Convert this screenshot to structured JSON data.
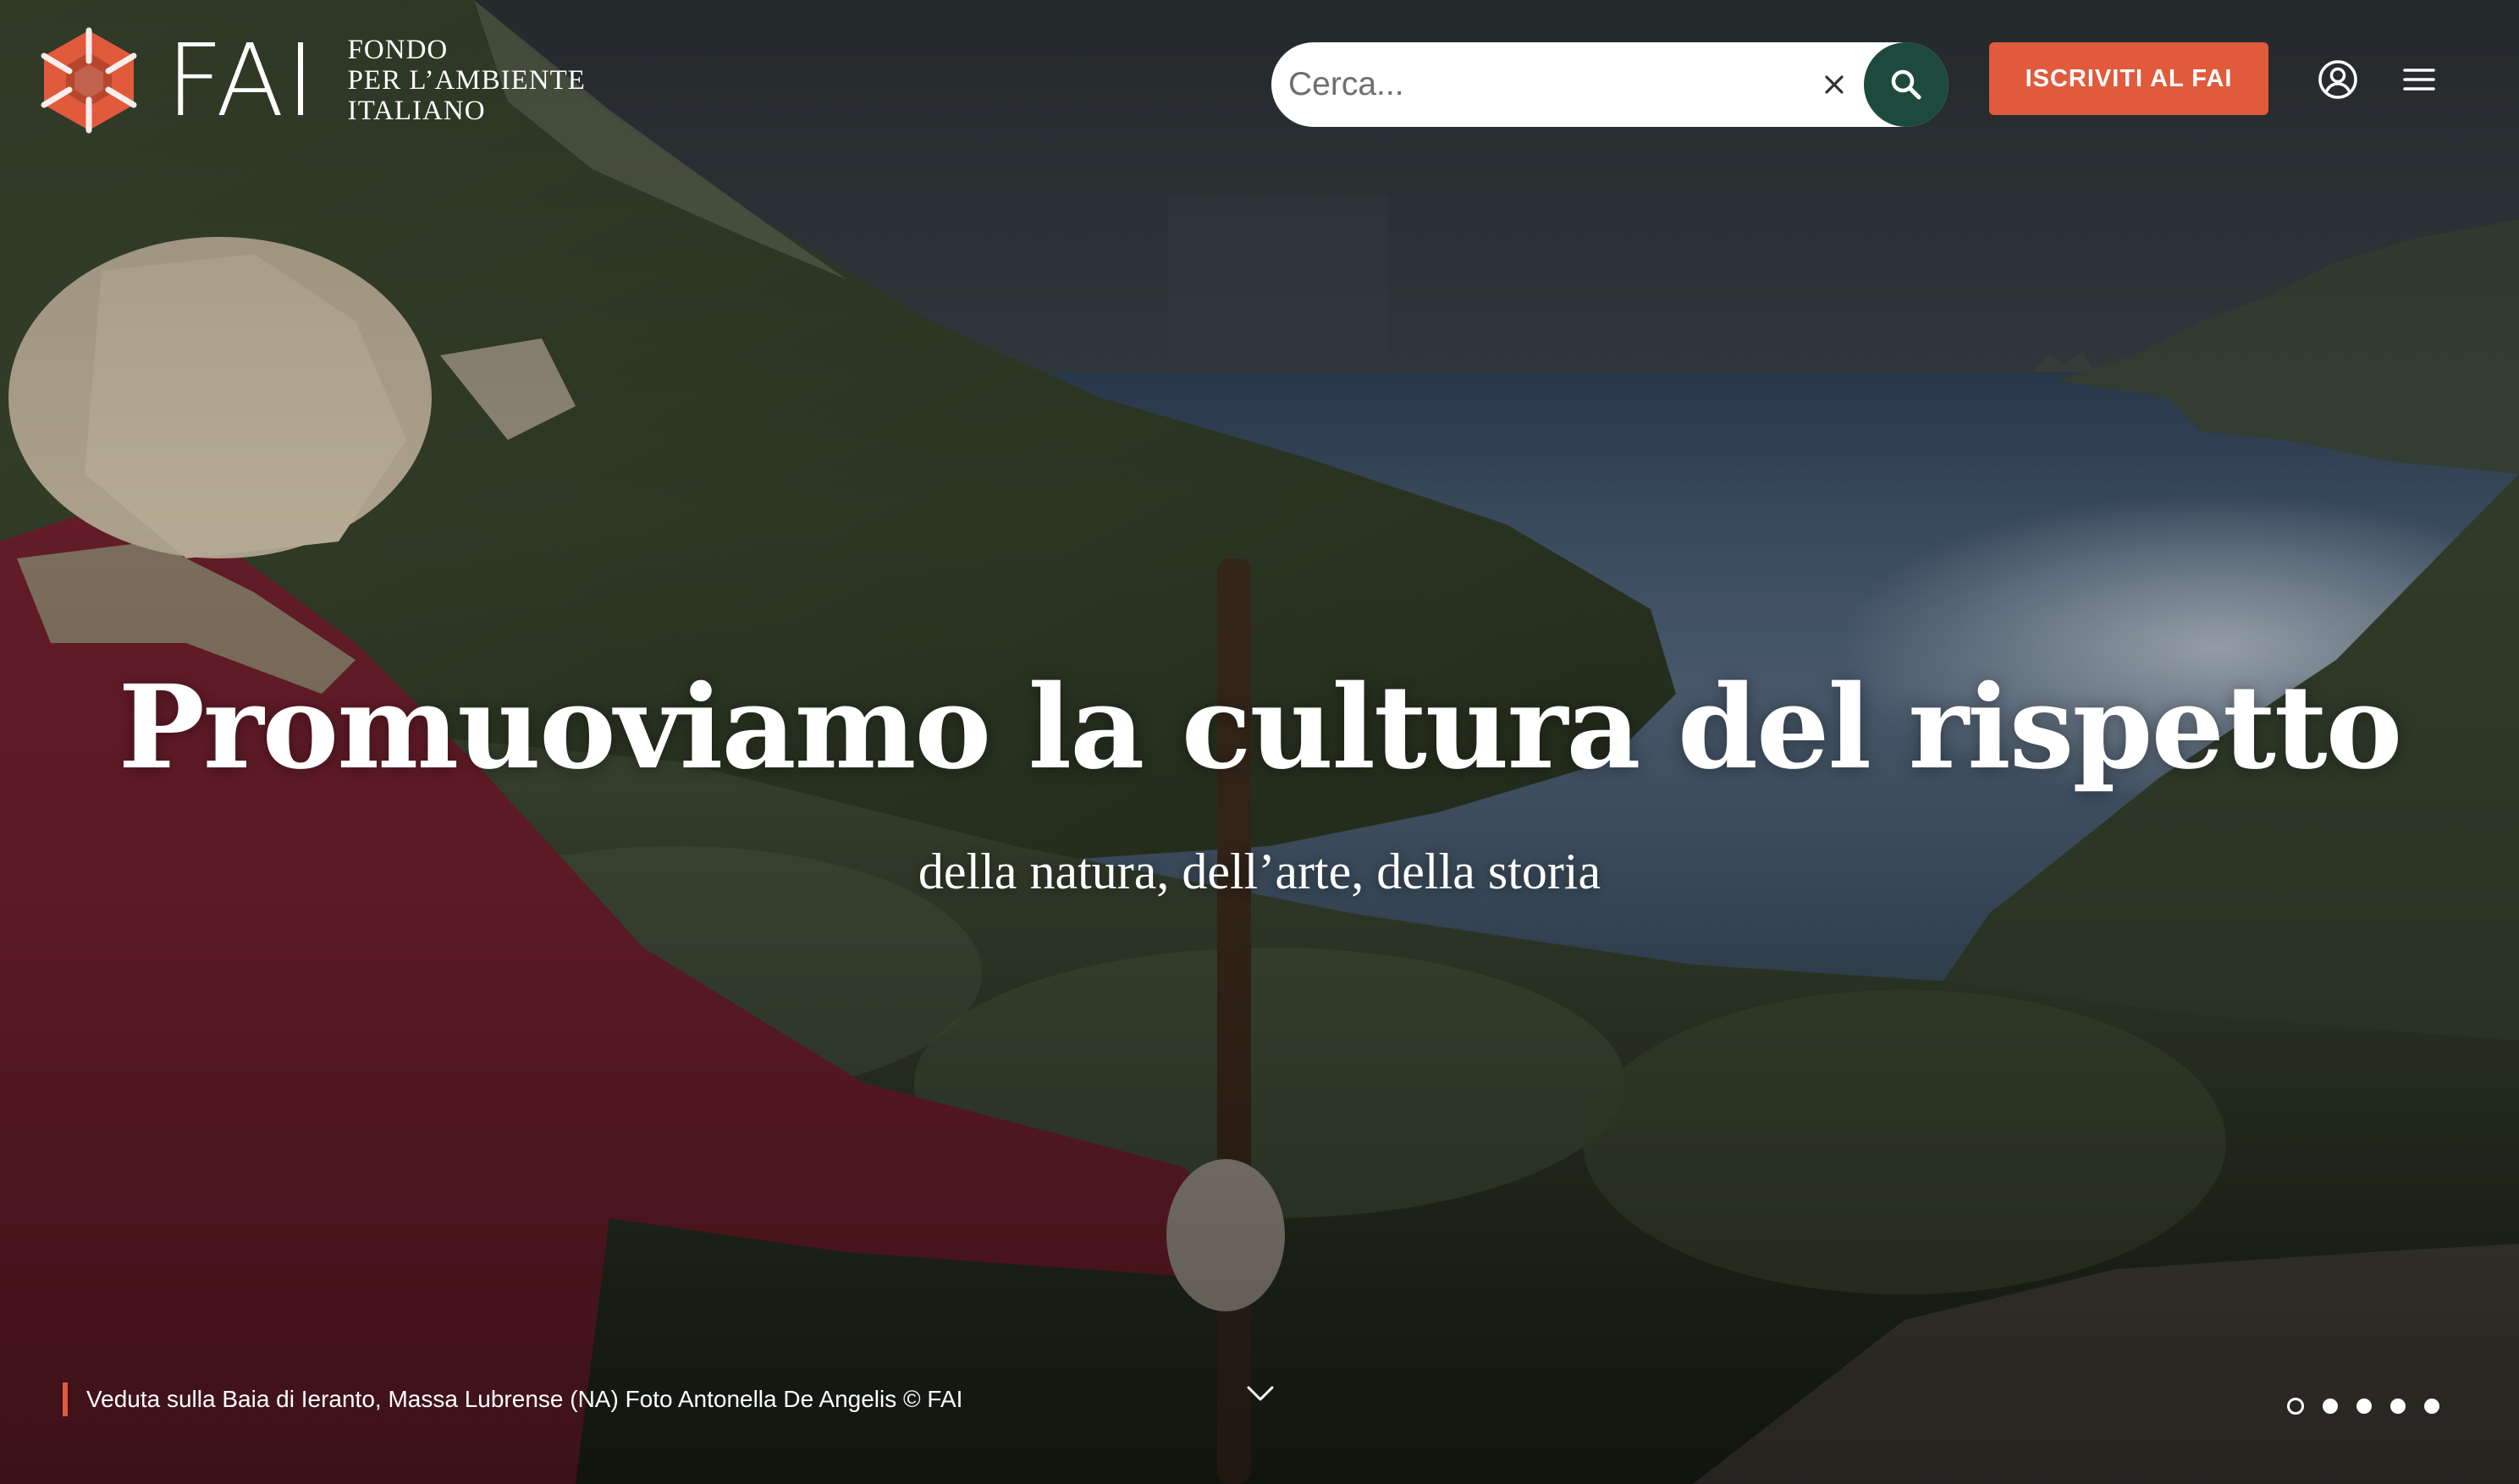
{
  "brand": {
    "name": "FAI",
    "tagline_lines": [
      "FONDO",
      "PER L’AMBIENTE",
      "ITALIANO"
    ],
    "color": "#e05a3b"
  },
  "search": {
    "placeholder": "Cerca...",
    "clear_icon": "close-icon",
    "submit_icon": "search-icon",
    "button_color": "#1d4a3c"
  },
  "header": {
    "cta_label": "ISCRIVITI AL FAI",
    "account_icon": "user-circle-icon",
    "menu_icon": "hamburger-menu-icon"
  },
  "hero": {
    "title": "Promuoviamo la cultura del rispetto",
    "subtitle": "della natura, dell’arte, della storia",
    "caption": "Veduta sulla Baia di Ieranto, Massa Lubrense (NA) Foto Antonella De Angelis © FAI",
    "scroll_icon": "chevron-down-icon",
    "slides": {
      "total": 5,
      "active_index": 0
    }
  }
}
